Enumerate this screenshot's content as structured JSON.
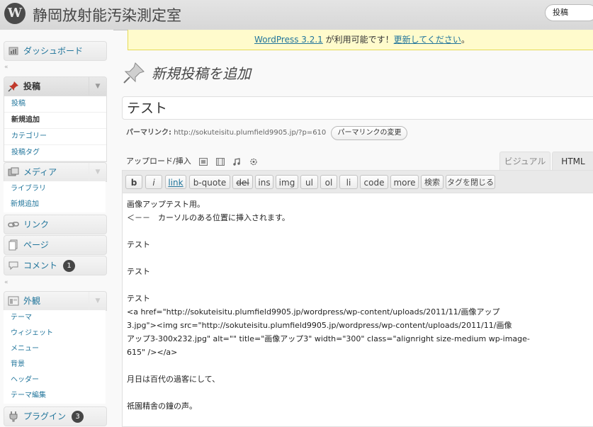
{
  "header": {
    "logo": "W",
    "site_title": "静岡放射能汚染測定室",
    "admin_menu": "投稿"
  },
  "sidebar": {
    "dashboard": "ダッシュボード",
    "posts": {
      "label": "投稿",
      "items": [
        "投稿",
        "新規追加",
        "カテゴリー",
        "投稿タグ"
      ]
    },
    "media": {
      "label": "メディア",
      "items": [
        "ライブラリ",
        "新規追加"
      ]
    },
    "links": "リンク",
    "pages": "ページ",
    "comments": {
      "label": "コメント",
      "count": "1"
    },
    "appearance": {
      "label": "外観",
      "items": [
        "テーマ",
        "ウィジェット",
        "メニュー",
        "背景",
        "ヘッダー",
        "テーマ編集"
      ]
    },
    "plugins": {
      "label": "プラグイン",
      "count": "3"
    },
    "collapse_glyph": "«"
  },
  "notice": {
    "link1": "WordPress 3.2.1",
    "text": " が利用可能です！",
    "link2": "更新してください",
    "end": "。"
  },
  "page": {
    "title": "新規投稿を追加"
  },
  "post": {
    "title": "テスト",
    "permalink_label": "パーマリンク:",
    "permalink_url": "http://sokuteisitu.plumfield9905.jp/?p=610",
    "permalink_button": "パーマリンクの変更"
  },
  "toolbar": {
    "upload_label": "アップロード/挿入",
    "tab_visual": "ビジュアル",
    "tab_html": "HTML",
    "quicktags": [
      "b",
      "i",
      "link",
      "b-quote",
      "del",
      "ins",
      "img",
      "ul",
      "ol",
      "li",
      "code",
      "more",
      "検索",
      "タグを閉じる"
    ]
  },
  "editor": {
    "lines": [
      "画像アップテスト用。",
      "＜－－　カーソルのある位置に挿入されます。",
      "",
      "テスト",
      "",
      "テスト",
      "",
      "テスト",
      "<a href=\"http://sokuteisitu.plumfield9905.jp/wordpress/wp-content/uploads/2011/11/画像アップ",
      "3.jpg\"><img src=\"http://sokuteisitu.plumfield9905.jp/wordpress/wp-content/uploads/2011/11/画像",
      "アップ3-300x232.jpg\" alt=\"\" title=\"画像アップ3\" width=\"300\"  class=\"alignright size-medium wp-image-",
      "615\" /></a>",
      "",
      "月日は百代の過客にして、",
      "",
      "祇園精舎の鐘の声。"
    ]
  },
  "colors": {
    "link": "#21759b",
    "notice_bg": "#fffbcc",
    "header_bg": "#dcdcdc"
  }
}
